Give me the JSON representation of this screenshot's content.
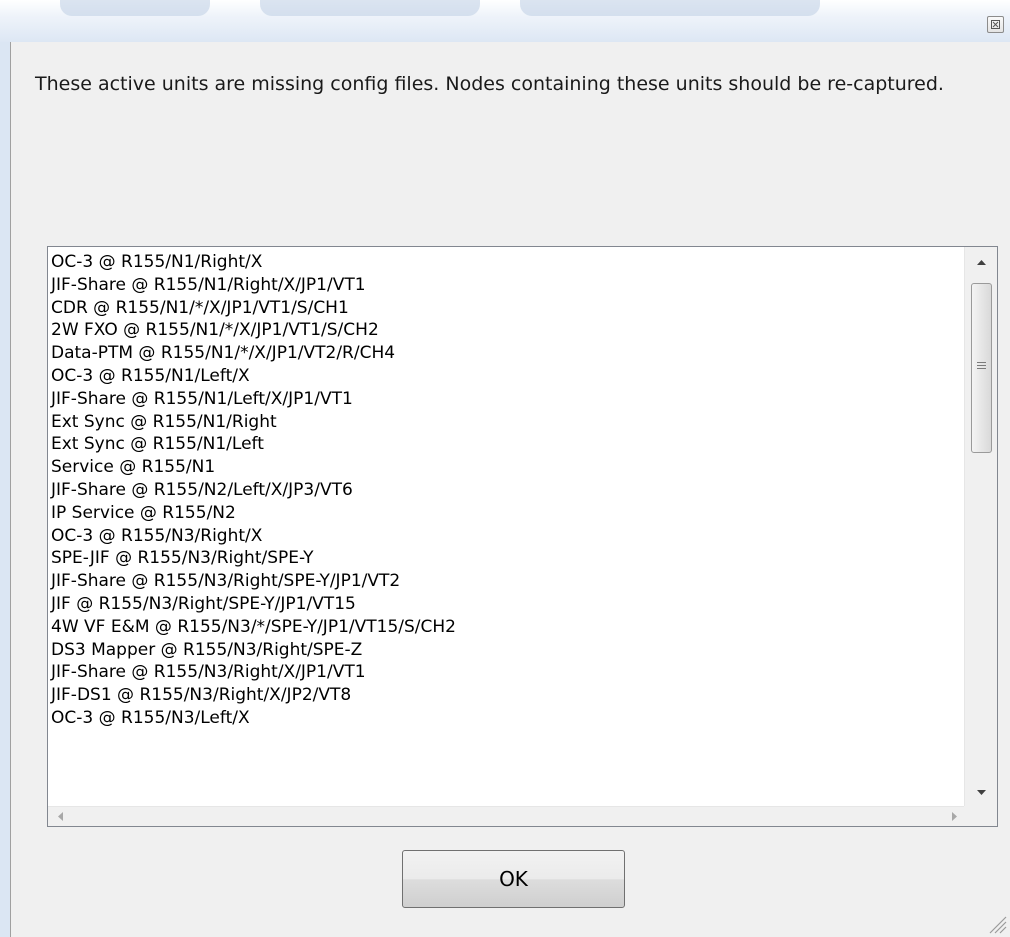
{
  "dialog": {
    "message": "These active units are missing config files. Nodes containing these units should be re-captured.",
    "ok_label": "OK",
    "close_icon": "close-icon"
  },
  "units": [
    "OC-3 @ R155/N1/Right/X",
    "JIF-Share @ R155/N1/Right/X/JP1/VT1",
    "CDR @ R155/N1/*/X/JP1/VT1/S/CH1",
    "2W FXO @ R155/N1/*/X/JP1/VT1/S/CH2",
    "Data-PTM @ R155/N1/*/X/JP1/VT2/R/CH4",
    "OC-3 @ R155/N1/Left/X",
    "JIF-Share @ R155/N1/Left/X/JP1/VT1",
    "Ext Sync @ R155/N1/Right",
    "Ext Sync @ R155/N1/Left",
    "Service @ R155/N1",
    "JIF-Share @ R155/N2/Left/X/JP3/VT6",
    "IP Service @ R155/N2",
    "OC-3 @ R155/N3/Right/X",
    "SPE-JIF @ R155/N3/Right/SPE-Y",
    "JIF-Share @ R155/N3/Right/SPE-Y/JP1/VT2",
    "JIF @ R155/N3/Right/SPE-Y/JP1/VT15",
    "4W VF E&M @ R155/N3/*/SPE-Y/JP1/VT15/S/CH2",
    "DS3 Mapper @ R155/N3/Right/SPE-Z",
    "JIF-Share @ R155/N3/Right/X/JP1/VT1",
    "JIF-DS1 @ R155/N3/Right/X/JP2/VT8",
    "OC-3 @ R155/N3/Left/X"
  ]
}
